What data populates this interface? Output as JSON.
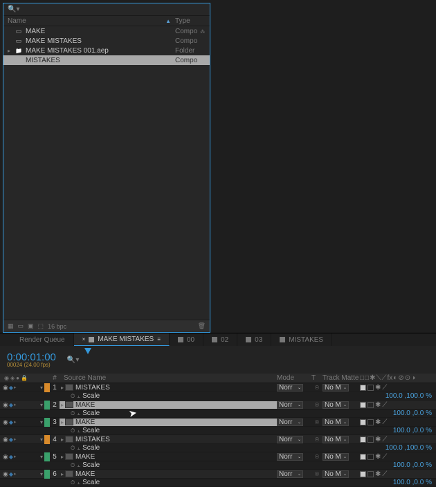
{
  "project": {
    "search_placeholder": "",
    "columns": {
      "name": "Name",
      "type": "Type"
    },
    "items": [
      {
        "name": "MAKE",
        "type": "Compo",
        "kind": "comp",
        "expander": "",
        "selected": false,
        "flow": true
      },
      {
        "name": "MAKE MISTAKES",
        "type": "Compo",
        "kind": "comp",
        "expander": "",
        "selected": false,
        "flow": false
      },
      {
        "name": "MAKE MISTAKES 001.aep",
        "type": "Folder",
        "kind": "folder",
        "expander": "▸",
        "selected": false,
        "flow": false
      },
      {
        "name": "MISTAKES",
        "type": "Compo",
        "kind": "comp",
        "expander": "",
        "selected": true,
        "flow": false
      }
    ],
    "footer": {
      "bpc": "16 bpc"
    }
  },
  "tabs": [
    {
      "label": "Render Queue",
      "active": false,
      "icon": false
    },
    {
      "label": "MAKE MISTAKES",
      "active": true,
      "icon": true,
      "menu": true
    },
    {
      "label": "00",
      "active": false,
      "icon": true
    },
    {
      "label": "02",
      "active": false,
      "icon": true
    },
    {
      "label": "03",
      "active": false,
      "icon": true
    },
    {
      "label": "MISTAKES",
      "active": false,
      "icon": true
    }
  ],
  "time": {
    "timecode": "0:00:01:00",
    "frames": "00024 (24.00 fps)"
  },
  "headers": {
    "idx": "#",
    "source": "Source Name",
    "mode": "Mode",
    "t": "T",
    "matte": "Track Matte"
  },
  "layers": [
    {
      "idx": 1,
      "color": "orange",
      "name": "MISTAKES",
      "selected": false,
      "mode": "Norr",
      "matte": "No M",
      "prop": {
        "name": "Scale",
        "value": "100.0 ,100.0 %"
      }
    },
    {
      "idx": 2,
      "color": "green",
      "name": "MAKE",
      "selected": true,
      "mode": "Norr",
      "matte": "No M",
      "prop": {
        "name": "Scale",
        "value": "100.0 ,0.0 %"
      }
    },
    {
      "idx": 3,
      "color": "green",
      "name": "MAKE",
      "selected": true,
      "mode": "Norr",
      "matte": "No M",
      "prop": {
        "name": "Scale",
        "value": "100.0 ,0.0 %"
      }
    },
    {
      "idx": 4,
      "color": "orange",
      "name": "MISTAKES",
      "selected": false,
      "mode": "Norr",
      "matte": "No M",
      "prop": {
        "name": "Scale",
        "value": "100.0 ,100.0 %"
      }
    },
    {
      "idx": 5,
      "color": "green",
      "name": "MAKE",
      "selected": false,
      "mode": "Norr",
      "matte": "No M",
      "prop": {
        "name": "Scale",
        "value": "100.0 ,0.0 %"
      }
    },
    {
      "idx": 6,
      "color": "green",
      "name": "MAKE",
      "selected": false,
      "mode": "Norr",
      "matte": "No M",
      "prop": {
        "name": "Scale",
        "value": "100.0 ,0.0 %"
      }
    }
  ]
}
